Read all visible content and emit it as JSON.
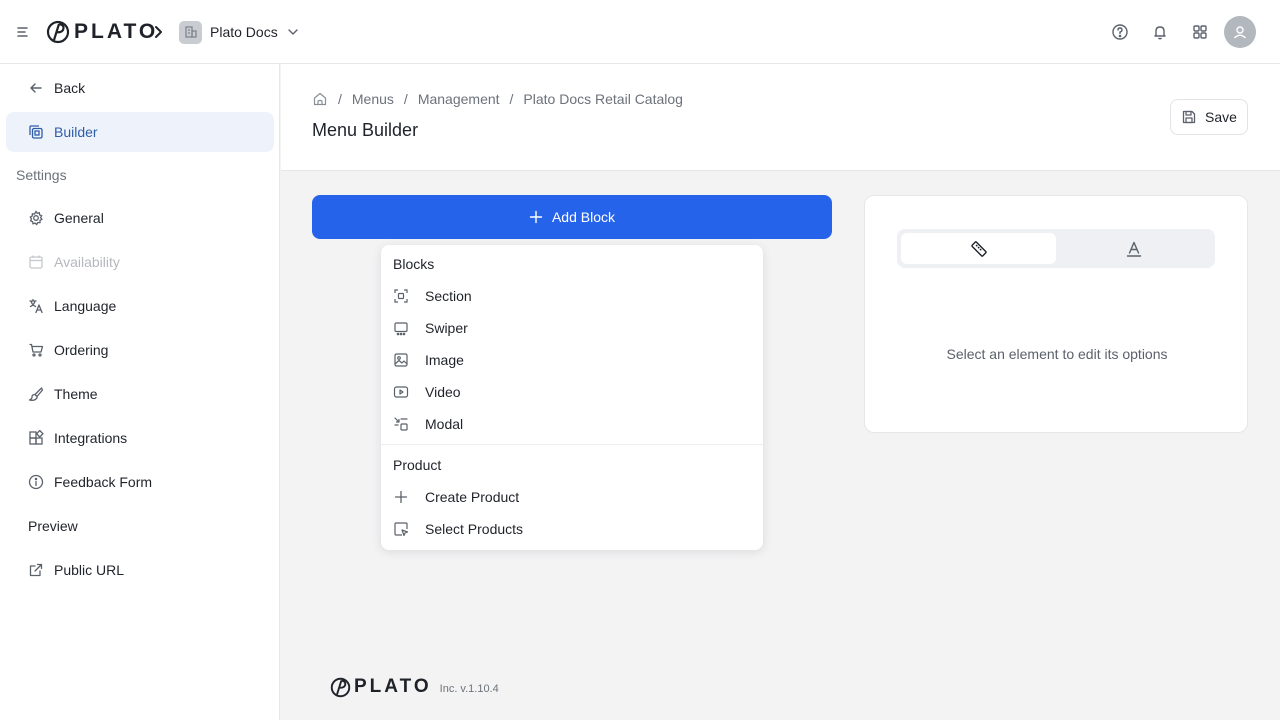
{
  "app": {
    "brand": "PLATO",
    "workspace": "Plato Docs",
    "footer_version": "Inc. v.1.10.4"
  },
  "topbar": {
    "icons": [
      "menu-toggle-icon",
      "help-icon",
      "bell-icon",
      "apps-grid-icon",
      "user-icon"
    ]
  },
  "sidebar": {
    "back": "Back",
    "builder": "Builder",
    "settings_heading": "Settings",
    "items": [
      {
        "label": "General",
        "icon": "gear-icon"
      },
      {
        "label": "Availability",
        "icon": "calendar-icon",
        "disabled": true
      },
      {
        "label": "Language",
        "icon": "translate-icon"
      },
      {
        "label": "Ordering",
        "icon": "cart-icon"
      },
      {
        "label": "Theme",
        "icon": "brush-icon"
      },
      {
        "label": "Integrations",
        "icon": "integrations-icon"
      },
      {
        "label": "Feedback Form",
        "icon": "info-icon"
      }
    ],
    "preview_heading": "Preview",
    "public_url": "Public URL"
  },
  "header": {
    "breadcrumb": [
      "Menus",
      "Management",
      "Plato Docs Retail Catalog"
    ],
    "title": "Menu Builder",
    "save_label": "Save"
  },
  "builder": {
    "add_block_label": "Add Block"
  },
  "dropdown": {
    "blocks_heading": "Blocks",
    "blocks": [
      {
        "label": "Section",
        "icon": "section-icon"
      },
      {
        "label": "Swiper",
        "icon": "swiper-icon"
      },
      {
        "label": "Image",
        "icon": "image-icon"
      },
      {
        "label": "Video",
        "icon": "video-icon"
      },
      {
        "label": "Modal",
        "icon": "modal-icon"
      }
    ],
    "product_heading": "Product",
    "product": [
      {
        "label": "Create Product",
        "icon": "plus-icon"
      },
      {
        "label": "Select Products",
        "icon": "select-products-icon"
      }
    ]
  },
  "options_panel": {
    "tabs": [
      {
        "icon": "ruler-icon",
        "active": true
      },
      {
        "icon": "typography-icon",
        "active": false
      }
    ],
    "empty_message": "Select an element to edit its options"
  },
  "colors": {
    "primary": "#2563eb",
    "active_nav_bg": "#eef3fb",
    "active_nav_text": "#2f5ea8"
  }
}
